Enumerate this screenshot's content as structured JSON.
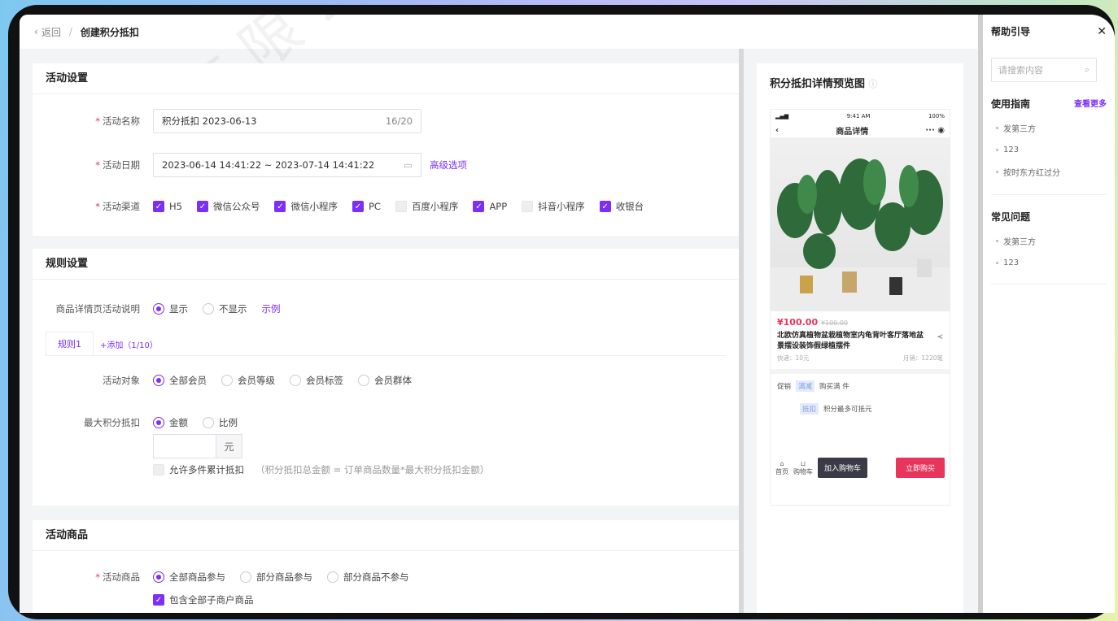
{
  "breadcrumb": {
    "back": "返回",
    "current": "创建积分抵扣"
  },
  "activity_settings": {
    "title": "活动设置",
    "name_label": "活动名称",
    "name_value": "积分抵扣 2023-06-13",
    "name_count": "16/20",
    "date_label": "活动日期",
    "date_value": "2023-06-14 14:41:22 ~ 2023-07-14 14:41:22",
    "advanced": "高级选项",
    "channel_label": "活动渠道",
    "channels": [
      {
        "label": "H5",
        "checked": true
      },
      {
        "label": "微信公众号",
        "checked": true
      },
      {
        "label": "微信小程序",
        "checked": true
      },
      {
        "label": "PC",
        "checked": true
      },
      {
        "label": "百度小程序",
        "checked": false
      },
      {
        "label": "APP",
        "checked": true
      },
      {
        "label": "抖音小程序",
        "checked": false
      },
      {
        "label": "收银台",
        "checked": true
      }
    ]
  },
  "rule_settings": {
    "title": "规则设置",
    "desc_label": "商品详情页活动说明",
    "desc_show": "显示",
    "desc_hide": "不显示",
    "desc_example": "示例",
    "tab": "规则1",
    "add": "+添加（1/10）",
    "target_label": "活动对象",
    "targets": [
      "全部会员",
      "会员等级",
      "会员标签",
      "会员群体"
    ],
    "max_label": "最大积分抵扣",
    "max_options": [
      "金额",
      "比例"
    ],
    "unit": "元",
    "multi_label": "允许多件累计抵扣",
    "multi_hint": "（积分抵扣总金额 = 订单商品数量*最大积分抵扣金额）"
  },
  "products": {
    "title": "活动商品",
    "label": "活动商品",
    "options": [
      "全部商品参与",
      "部分商品参与",
      "部分商品不参与"
    ],
    "include_sub": "包含全部子商户商品"
  },
  "preview": {
    "title": "积分抵扣详情预览图",
    "status_time": "9:41 AM",
    "status_battery": "100%",
    "page_title": "商品详情",
    "price": "¥100.00",
    "old_price": "¥100.00",
    "product_name": "北欧仿真植物盆栽植物室内龟背叶客厅落地盆景摆设装饰假绿植摆件",
    "shipping": "快递：10元",
    "sales": "月销：1220笔",
    "promo_label": "促销",
    "promo_tag1": "满减",
    "promo_text1": "购买满 件",
    "promo_tag2": "抵扣",
    "promo_text2": "积分最多可抵元",
    "nav_home": "首页",
    "nav_cart": "购物车",
    "add_cart": "加入购物车",
    "buy_now": "立即购买"
  },
  "help": {
    "title": "帮助引导",
    "search_placeholder": "请搜索内容",
    "guide_title": "使用指南",
    "more": "查看更多",
    "guides": [
      "发第三方",
      "123",
      "按时东方红过分"
    ],
    "faq_title": "常见问题",
    "faqs": [
      "发第三方",
      "123"
    ]
  },
  "colors": {
    "accent": "#7b2ff7",
    "buy": "#e8355b",
    "cart": "#3b3b48"
  }
}
